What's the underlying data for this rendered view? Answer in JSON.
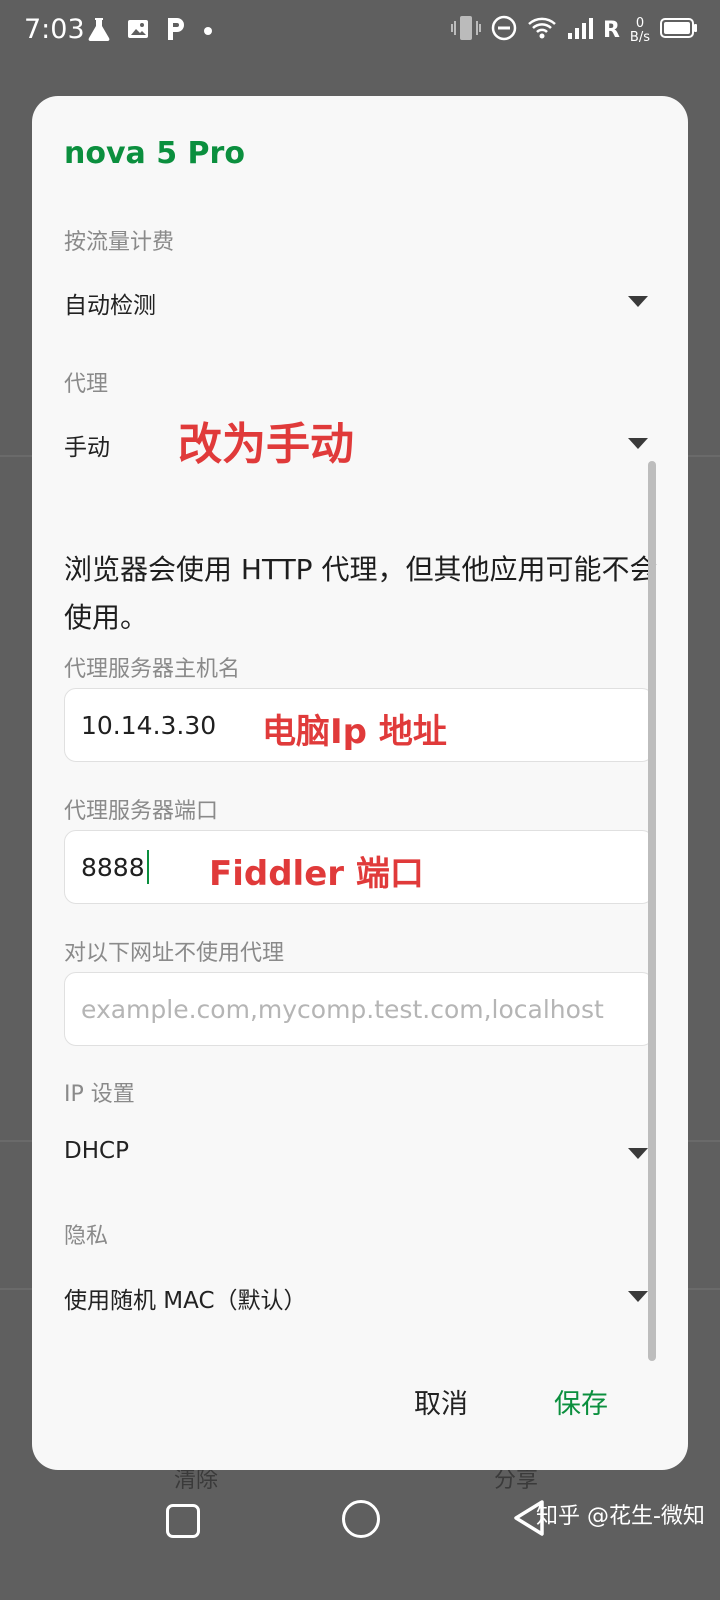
{
  "status_bar": {
    "time": "7:03",
    "net_speed_value": "0",
    "net_speed_unit": "B/s",
    "roaming": "R"
  },
  "dialog": {
    "title": "nova 5 Pro",
    "metered": {
      "label": "按流量计费",
      "value": "自动检测"
    },
    "proxy": {
      "label": "代理",
      "value": "手动"
    },
    "note": "浏览器会使用 HTTP 代理，但其他应用可能不会使用。",
    "proxy_host": {
      "label": "代理服务器主机名",
      "value": "10.14.3.30"
    },
    "proxy_port": {
      "label": "代理服务器端口",
      "value": "8888"
    },
    "bypass": {
      "label": "对以下网址不使用代理",
      "placeholder": "example.com,mycomp.test.com,localhost"
    },
    "ip_settings": {
      "label": "IP 设置",
      "value": "DHCP"
    },
    "privacy": {
      "label": "隐私",
      "value": "使用随机 MAC（默认）"
    },
    "cancel_label": "取消",
    "save_label": "保存"
  },
  "annotations": {
    "proxy_note": "改为手动",
    "host_note": "电脑Ip 地址",
    "port_note": "Fiddler 端口"
  },
  "background": {
    "left_button": "清除",
    "right_button": "分享"
  },
  "watermark": "知乎 @花生-微知",
  "colors": {
    "accent": "#0b8f3e",
    "annotation": "#e03a3a"
  }
}
